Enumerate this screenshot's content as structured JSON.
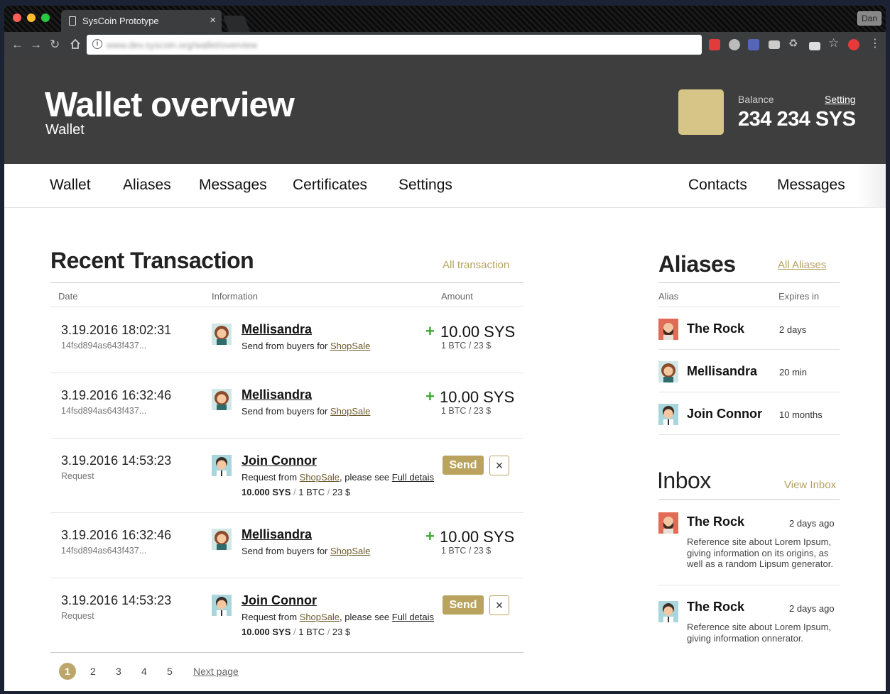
{
  "browser": {
    "tab_title": "SysCoin Prototype",
    "tab_close": "×",
    "profile": "Dan",
    "url": "www.dev.syscoin.org/wallet/overview",
    "info_icon": "i"
  },
  "header": {
    "title": "Wallet overview",
    "subtitle": "Wallet",
    "balance_label": "Balance",
    "balance_value": "234 234 SYS",
    "setting_link": "Setting"
  },
  "nav": {
    "left": [
      "Wallet",
      "Aliases",
      "Messages",
      "Certificates",
      "Settings"
    ],
    "right": [
      "Contacts",
      "Messages"
    ]
  },
  "transactions": {
    "title": "Recent Transaction",
    "all_link": "All transaction",
    "columns": [
      "Date",
      "Information",
      "Amount"
    ],
    "rows": [
      {
        "date": "3.19.2016 18:02:31",
        "meta": "14fsd894as643f437...",
        "name": "Mellisandra",
        "desc_prefix": "Send from buyers for ",
        "desc_link": "ShopSale",
        "plus": "+",
        "amount": "10.00 SYS",
        "amount_sub": "1 BTC / 23 $"
      },
      {
        "date": "3.19.2016 16:32:46",
        "meta": "14fsd894as643f437...",
        "name": "Mellisandra",
        "desc_prefix": "Send from buyers for ",
        "desc_link": "ShopSale",
        "plus": "+",
        "amount": "10.00 SYS",
        "amount_sub": "1 BTC / 23 $"
      },
      {
        "date": "3.19.2016 14:53:23",
        "meta": "Request",
        "name": "Join Connor",
        "desc_prefix": "Request from ",
        "desc_link": "ShopSale",
        "desc_mid": ", please see ",
        "desc_link2": "Full detais",
        "req_sys": "10.000 SYS",
        "req_sep": " / ",
        "req_btc": "1 BTC",
        "req_usd": "23 $",
        "send": "Send",
        "close": "×"
      },
      {
        "date": "3.19.2016 16:32:46",
        "meta": "14fsd894as643f437...",
        "name": "Mellisandra",
        "desc_prefix": "Send from buyers for ",
        "desc_link": "ShopSale",
        "plus": "+",
        "amount": "10.00 SYS",
        "amount_sub": "1 BTC / 23 $"
      },
      {
        "date": "3.19.2016 14:53:23",
        "meta": "Request",
        "name": "Join Connor",
        "desc_prefix": "Request from ",
        "desc_link": "ShopSale",
        "desc_mid": ", please see ",
        "desc_link2": "Full detais",
        "req_sys": "10.000 SYS",
        "req_sep": " / ",
        "req_btc": "1 BTC",
        "req_usd": "23 $",
        "send": "Send",
        "close": "×"
      }
    ],
    "pages": [
      "1",
      "2",
      "3",
      "4",
      "5"
    ],
    "next_page": "Next page"
  },
  "aliases": {
    "title": "Aliases",
    "all_link": "All Aliases",
    "columns": [
      "Alias",
      "Expires in"
    ],
    "rows": [
      {
        "name": "The Rock",
        "expires": "2 days",
        "avatar": "rock"
      },
      {
        "name": "Mellisandra",
        "expires": "20 min",
        "avatar": "mel"
      },
      {
        "name": "Join Connor",
        "expires": "10 months",
        "avatar": "connor"
      }
    ]
  },
  "inbox": {
    "title": "Inbox",
    "view_link": "View Inbox",
    "messages": [
      {
        "name": "The Rock",
        "time": "2 days ago",
        "body": "Reference site about Lorem Ipsum, giving information on its origins, as well as a random Lipsum generator.",
        "avatar": "rock"
      },
      {
        "name": "The Rock",
        "time": "2 days ago",
        "body": "Reference site about Lorem Ipsum, giving information onnerator.",
        "avatar": "connor"
      }
    ]
  },
  "colors": {
    "accent": "#b9a35e",
    "hero_bg": "#3e3e3e",
    "positive": "#3fa535"
  }
}
